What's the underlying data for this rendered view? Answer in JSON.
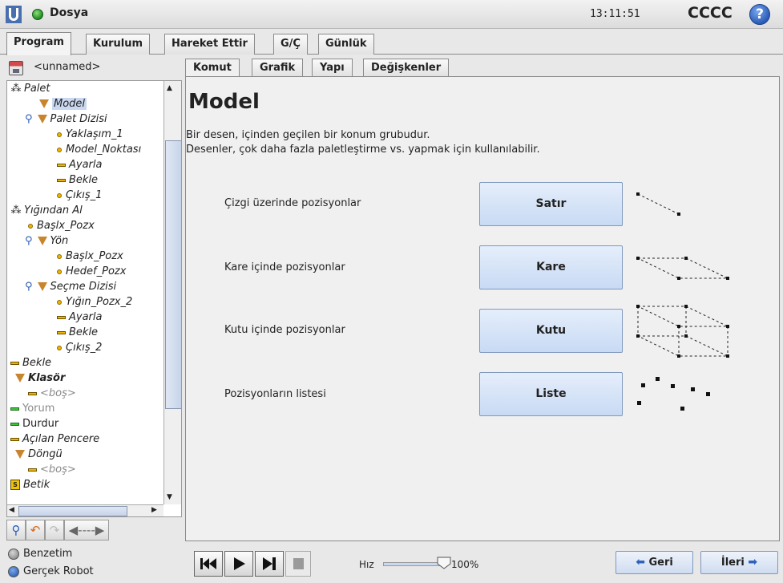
{
  "topbar": {
    "file_label": "Dosya",
    "clock": "13:11:51",
    "robot_name": "CCCC",
    "help_glyph": "?",
    "status_color": "#2e9e2e"
  },
  "main_tabs": [
    "Program",
    "Kurulum",
    "Hareket Ettir",
    "G/Ç",
    "Günlük"
  ],
  "active_main_tab": "Program",
  "left": {
    "file_name": "<unnamed>",
    "tree": [
      {
        "label": "Palet",
        "icon": "palette-icon",
        "italic": true
      },
      {
        "label": "Model",
        "icon": "triangle-icon",
        "italic": true,
        "selected": true
      },
      {
        "label": "Palet Dizisi",
        "icon": "triangle-icon",
        "italic": true
      },
      {
        "label": "Yaklaşım_1",
        "icon": "waypoint-icon",
        "italic": true
      },
      {
        "label": "Model_Noktası",
        "icon": "waypoint-icon",
        "italic": true
      },
      {
        "label": "Ayarla",
        "icon": "bar-icon",
        "italic": true
      },
      {
        "label": "Bekle",
        "icon": "bar-icon",
        "italic": true
      },
      {
        "label": "Çıkış_1",
        "icon": "waypoint-icon",
        "italic": true
      },
      {
        "label": "Yığından Al",
        "icon": "palette-icon",
        "italic": true
      },
      {
        "label": "Başlx_Pozx",
        "icon": "waypoint-icon",
        "italic": true
      },
      {
        "label": "Yön",
        "icon": "triangle-icon",
        "italic": true
      },
      {
        "label": "Başlx_Pozx",
        "icon": "waypoint-icon",
        "italic": true
      },
      {
        "label": "Hedef_Pozx",
        "icon": "waypoint-icon",
        "italic": true
      },
      {
        "label": "Seçme Dizisi",
        "icon": "triangle-icon",
        "italic": true
      },
      {
        "label": "Yığın_Pozx_2",
        "icon": "waypoint-icon",
        "italic": true
      },
      {
        "label": "Ayarla",
        "icon": "bar-icon",
        "italic": true
      },
      {
        "label": "Bekle",
        "icon": "bar-icon",
        "italic": true
      },
      {
        "label": "Çıkış_2",
        "icon": "waypoint-icon",
        "italic": true
      },
      {
        "label": "Bekle",
        "icon": "bar-icon",
        "italic": true
      },
      {
        "label": "Klasör",
        "icon": "triangle-icon",
        "italic": true,
        "bold": true
      },
      {
        "label": "<boş>",
        "icon": "bar-icon",
        "italic": true,
        "gray": true
      },
      {
        "label": "Yorum",
        "icon": "bar-icon-green",
        "gray": true
      },
      {
        "label": "Durdur",
        "icon": "bar-icon-green"
      },
      {
        "label": "Açılan Pencere",
        "icon": "bar-icon",
        "italic": true
      },
      {
        "label": "Döngü",
        "icon": "triangle-icon",
        "italic": true
      },
      {
        "label": "<boş>",
        "icon": "bar-icon",
        "italic": true,
        "gray": true
      },
      {
        "label": "Betik",
        "icon": "script-icon",
        "italic": true
      }
    ]
  },
  "sub_tabs": [
    "Komut",
    "Grafik",
    "Yapı",
    "Değişkenler"
  ],
  "active_sub_tab": "Komut",
  "content": {
    "title": "Model",
    "desc_line1": "Bir desen, içinden geçilen bir konum grubudur.",
    "desc_line2": "Desenler, çok daha fazla paletleştirme vs. yapmak için kullanılabilir.",
    "rows": [
      {
        "label": "Çizgi üzerinde pozisyonlar",
        "button": "Satır",
        "pattern": "line-pattern-icon"
      },
      {
        "label": "Kare içinde pozisyonlar",
        "button": "Kare",
        "pattern": "square-pattern-icon"
      },
      {
        "label": "Kutu içinde pozisyonlar",
        "button": "Kutu",
        "pattern": "box-pattern-icon"
      },
      {
        "label": "Pozisyonların listesi",
        "button": "Liste",
        "pattern": "list-pattern-icon"
      }
    ]
  },
  "bottom": {
    "mode_sim": "Benzetim",
    "mode_real": "Gerçek Robot",
    "speed_label": "Hız",
    "speed_value": "100%",
    "speed_fraction": 1.0,
    "back_label": "Geri",
    "next_label": "İleri"
  }
}
